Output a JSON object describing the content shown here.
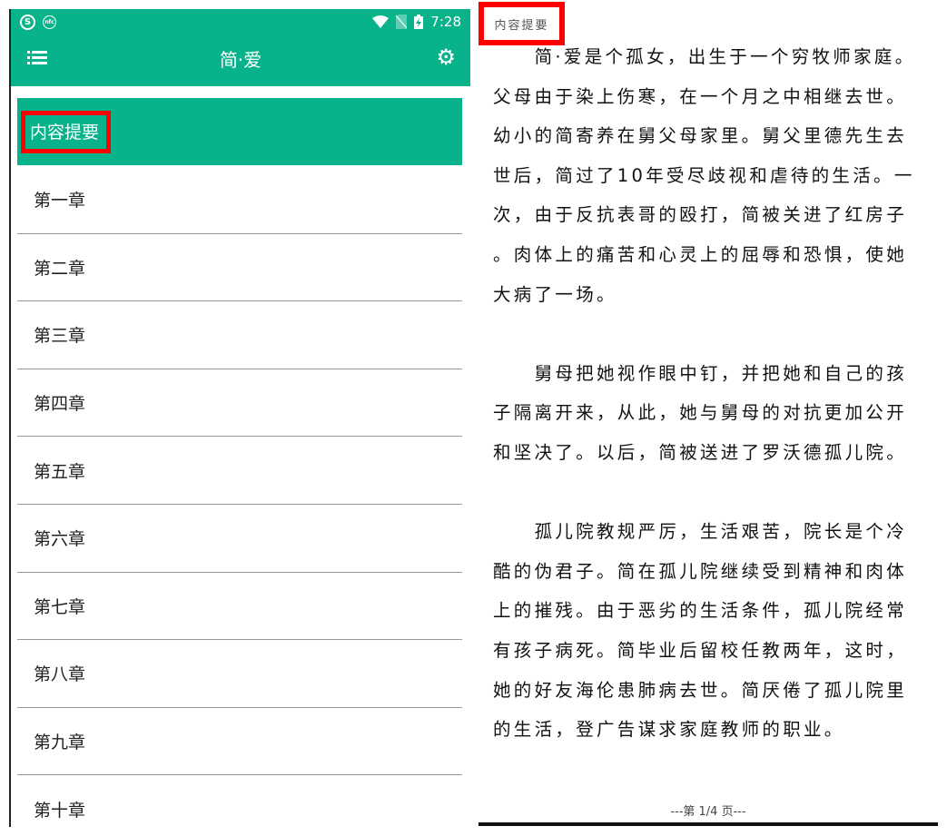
{
  "status_bar": {
    "time": "7:28",
    "left_icons": [
      "sogou-icon",
      "nfc-icon"
    ],
    "right_icons": [
      "wifi-icon",
      "no-sim-icon",
      "battery-charging-icon"
    ]
  },
  "app_bar": {
    "title": "简·爱",
    "menu_icon": "menu-list-icon",
    "settings_icon": "gear-icon"
  },
  "toc": {
    "items": [
      {
        "label": "内容提要",
        "selected": true
      },
      {
        "label": "第一章"
      },
      {
        "label": "第二章"
      },
      {
        "label": "第三章"
      },
      {
        "label": "第四章"
      },
      {
        "label": "第五章"
      },
      {
        "label": "第六章"
      },
      {
        "label": "第七章"
      },
      {
        "label": "第八章"
      },
      {
        "label": "第九章"
      },
      {
        "label": "第十章"
      }
    ]
  },
  "reader": {
    "section_title": "内容提要",
    "paragraphs": [
      [
        "　　简·爱是个孤女，出生于一个穷牧师家庭。",
        "父母由于染上伤寒，在一个月之中相继去世。",
        "幼小的简寄养在舅父母家里。舅父里德先生去",
        "世后，简过了10年受尽歧视和虐待的生活。一",
        "次，由于反抗表哥的殴打，简被关进了红房子",
        "。肉体上的痛苦和心灵上的屈辱和恐惧，使她",
        "大病了一场。"
      ],
      [
        "　　舅母把她视作眼中钉，并把她和自己的孩",
        "子隔离开来，从此，她与舅母的对抗更加公开",
        "和坚决了。以后，简被送进了罗沃德孤儿院。"
      ],
      [
        "　　孤儿院教规严厉，生活艰苦，院长是个冷",
        "酷的伪君子。简在孤儿院继续受到精神和肉体",
        "上的摧残。由于恶劣的生活条件，孤儿院经常",
        "有孩子病死。简毕业后留校任教两年，这时，",
        "她的好友海伦患肺病去世。简厌倦了孤儿院里",
        "的生活，登广告谋求家庭教师的职业。"
      ]
    ],
    "page_indicator": "---第 1/4 页---"
  },
  "colors": {
    "accent": "#08b38b",
    "highlight": "#ff0000"
  }
}
